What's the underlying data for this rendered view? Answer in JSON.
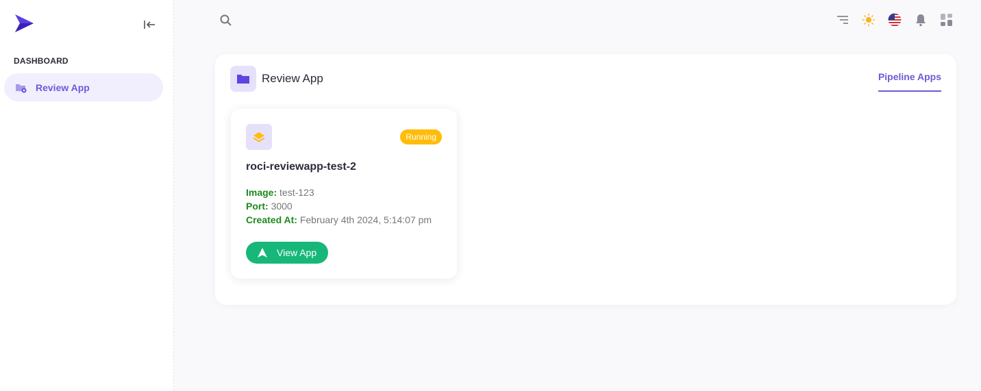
{
  "sidebar": {
    "section_title": "DASHBOARD",
    "items": [
      {
        "label": "Review App",
        "icon": "folder-gear-icon",
        "active": true
      }
    ]
  },
  "topbar": {
    "icons": [
      "search-icon",
      "filter-lines-icon",
      "sun-icon",
      "us-flag-icon",
      "bell-icon",
      "apps-grid-icon"
    ]
  },
  "panel": {
    "title": "Review App",
    "tab_label": "Pipeline Apps"
  },
  "apps": [
    {
      "name": "roci-reviewapp-test-2",
      "status": "Running",
      "image_label": "Image:",
      "image_value": "test-123",
      "port_label": "Port:",
      "port_value": "3000",
      "created_label": "Created At:",
      "created_value": "February 4th 2024, 5:14:07 pm",
      "button_label": "View App"
    }
  ],
  "colors": {
    "accent": "#6b5bd6",
    "status_running": "#ffbc0a",
    "button_green": "#17b77a",
    "meta_label_green": "#1d8a1d"
  }
}
